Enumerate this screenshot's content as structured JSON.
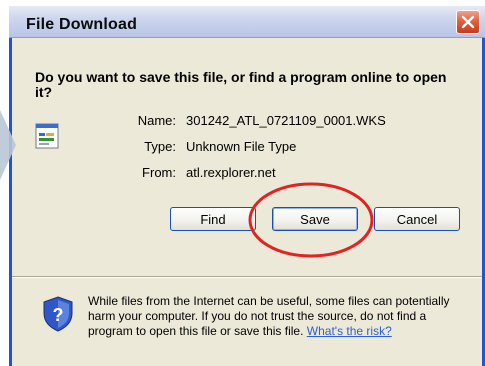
{
  "window": {
    "title": "File Download",
    "close_icon": "close-icon"
  },
  "question": "Do you want to save this file, or find a program online to open it?",
  "file": {
    "icon": "document-icon",
    "name_label": "Name:",
    "name_value": "301242_ATL_0721109_0001.WKS",
    "type_label": "Type:",
    "type_value": "Unknown File Type",
    "from_label": "From:",
    "from_value": "atl.rexplorer.net"
  },
  "buttons": {
    "find": "Find",
    "save": "Save",
    "cancel": "Cancel"
  },
  "annotation": {
    "highlight_color": "#e02424"
  },
  "warning": {
    "icon": "security-shield-icon",
    "text": "While files from the Internet can be useful, some files can potentially harm your computer. If you do not trust the source, do not find a program to open this file or save this file.",
    "link": "What's the risk?"
  },
  "colors": {
    "frame_border": "#1d54d8",
    "dialog_bg": "#ece9d8",
    "close_button": "#d9532f",
    "link": "#2c5fd8"
  }
}
